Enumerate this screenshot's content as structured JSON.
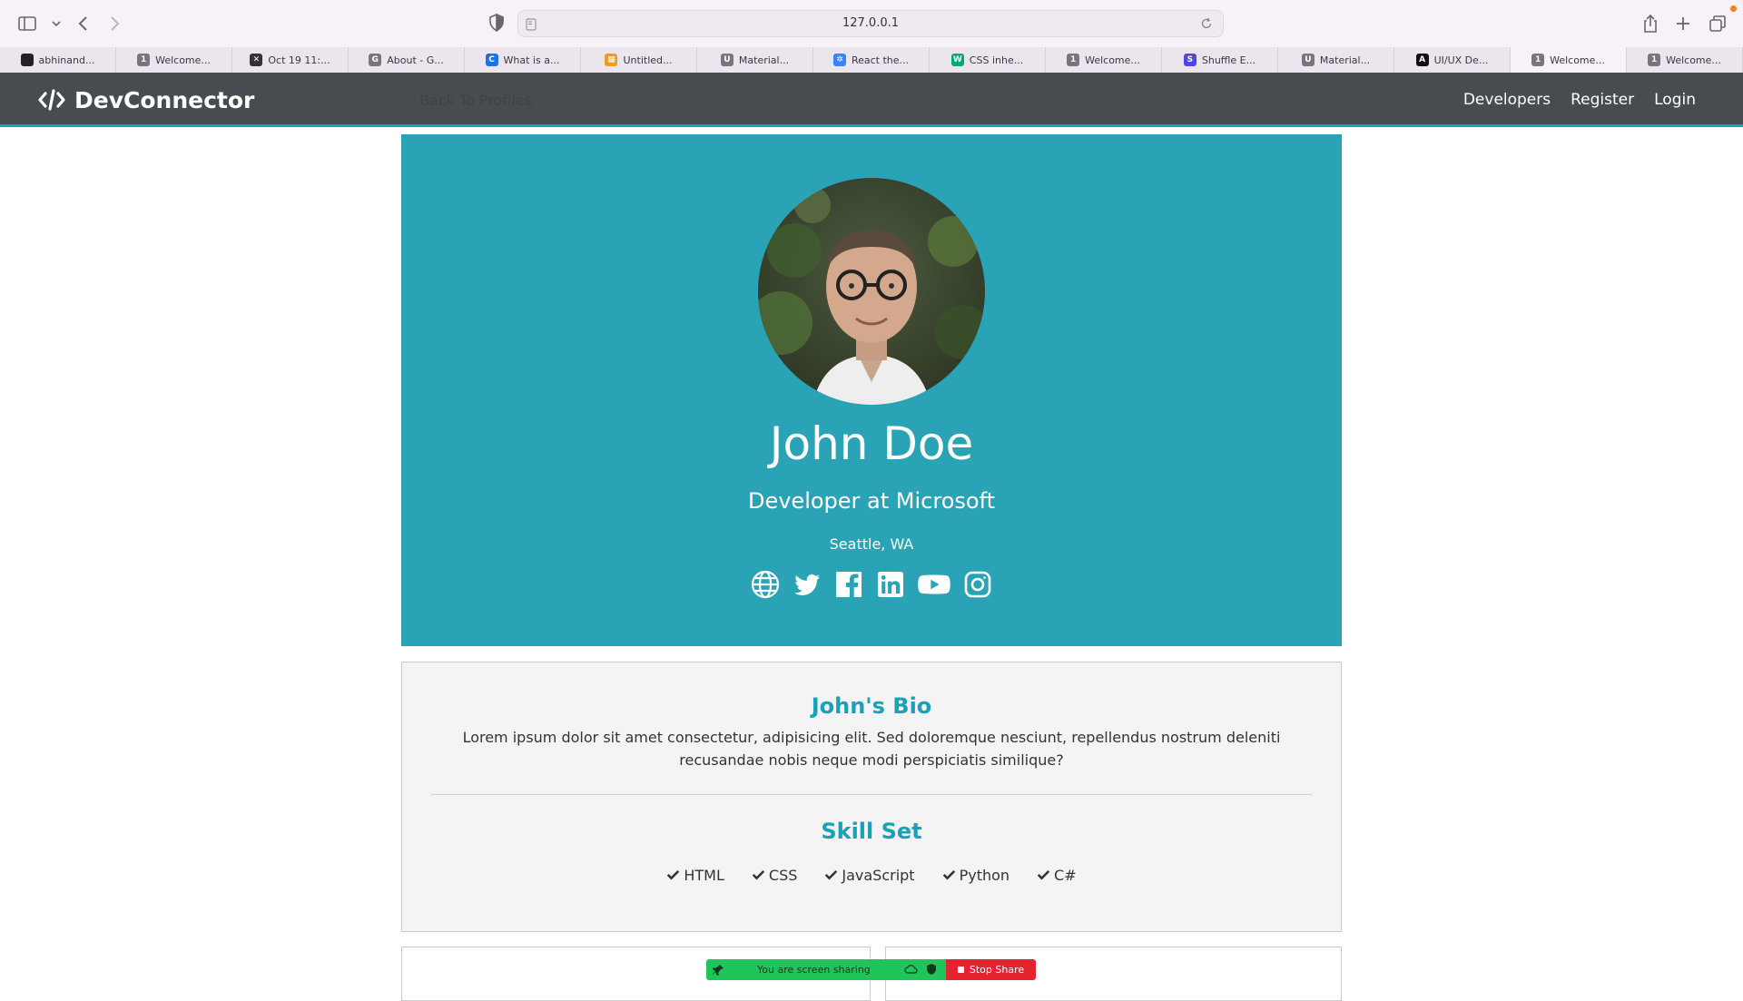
{
  "browser": {
    "url": "127.0.0.1",
    "tabs": [
      {
        "label": "abhinand...",
        "icon": "github-icon",
        "color": "#222222",
        "glyph": ""
      },
      {
        "label": "Welcome...",
        "icon": "app-icon",
        "color": "#7a7480",
        "glyph": "1"
      },
      {
        "label": "Oct 19 11:...",
        "icon": "x-cross-icon",
        "color": "#333333",
        "glyph": "✕"
      },
      {
        "label": "About - G...",
        "icon": "g-icon",
        "color": "#7a7480",
        "glyph": "G"
      },
      {
        "label": "What is a...",
        "icon": "swirl-icon",
        "color": "#1a73e8",
        "glyph": "C"
      },
      {
        "label": "Untitled...",
        "icon": "grid-icon",
        "color": "#f29a1a",
        "glyph": "▦"
      },
      {
        "label": "Material...",
        "icon": "u-icon",
        "color": "#7a7480",
        "glyph": "U"
      },
      {
        "label": "React the...",
        "icon": "react-icon",
        "color": "#3b82f6",
        "glyph": "✲"
      },
      {
        "label": "CSS inhe...",
        "icon": "w-icon",
        "color": "#04aa6d",
        "glyph": "W"
      },
      {
        "label": "Welcome...",
        "icon": "app-icon",
        "color": "#7a7480",
        "glyph": "1"
      },
      {
        "label": "Shuffle E...",
        "icon": "shuffle-icon",
        "color": "#4f46e5",
        "glyph": "S"
      },
      {
        "label": "Material...",
        "icon": "u-icon",
        "color": "#7a7480",
        "glyph": "U"
      },
      {
        "label": "UI/UX De...",
        "icon": "uiux-icon",
        "color": "#111111",
        "glyph": "A"
      },
      {
        "label": "Welcome...",
        "icon": "app-icon",
        "color": "#7a7480",
        "glyph": "1"
      },
      {
        "label": "Welcome...",
        "icon": "app-icon",
        "color": "#7a7480",
        "glyph": "1"
      }
    ]
  },
  "navbar": {
    "brand": "DevConnector",
    "back_link": "Back To Profiles",
    "links": [
      "Developers",
      "Register",
      "Login"
    ]
  },
  "profile": {
    "name": "John Doe",
    "title": "Developer at Microsoft",
    "location": "Seattle, WA",
    "socials": [
      "globe-icon",
      "twitter-icon",
      "facebook-icon",
      "linkedin-icon",
      "youtube-icon",
      "instagram-icon"
    ]
  },
  "about": {
    "bio_heading": "John's Bio",
    "bio_text": "Lorem ipsum dolor sit amet consectetur, adipisicing elit. Sed doloremque nesciunt, repellendus nostrum deleniti recusandae nobis neque modi perspiciatis similique?",
    "skills_heading": "Skill Set",
    "skills": [
      "HTML",
      "CSS",
      "JavaScript",
      "Python",
      "C#"
    ]
  },
  "share_bar": {
    "status": "You are screen sharing",
    "stop_label": "Stop Share"
  },
  "colors": {
    "primary": "#17a2b8",
    "navbar": "#484c50",
    "share_green": "#1fc45b",
    "share_red": "#e5232e"
  }
}
